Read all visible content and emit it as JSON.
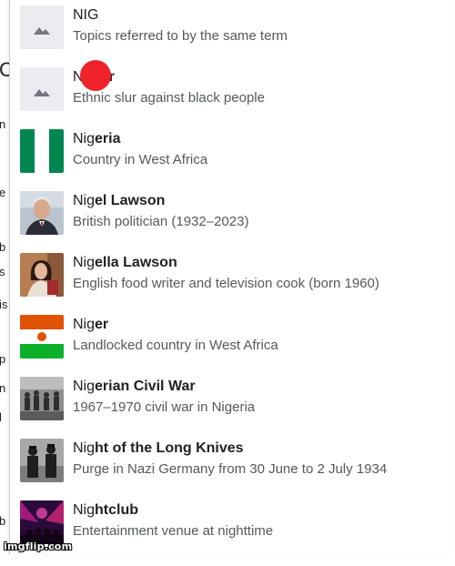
{
  "background_fragments": [
    "C",
    "n",
    "e",
    "b",
    "s",
    "is",
    "p",
    "n",
    "l",
    "b"
  ],
  "suggestions": [
    {
      "title_prefix": "NIG",
      "title_rest": "",
      "description": "Topics referred to by the same term",
      "thumb": "placeholder-image-icon"
    },
    {
      "title_prefix": "N",
      "title_rest": "r",
      "description": "Ethnic slur against black people",
      "thumb": "placeholder-image-icon"
    },
    {
      "title_prefix": "Nig",
      "title_rest": "eria",
      "description": "Country in West Africa",
      "thumb": "nigeria-flag"
    },
    {
      "title_prefix": "Nig",
      "title_rest": "el Lawson",
      "description": "British politician (1932–2023)",
      "thumb": "portrait-photo"
    },
    {
      "title_prefix": "Nig",
      "title_rest": "ella Lawson",
      "description": "English food writer and television cook (born 1960)",
      "thumb": "portrait-photo"
    },
    {
      "title_prefix": "Nig",
      "title_rest": "er",
      "description": "Landlocked country in West Africa",
      "thumb": "niger-flag"
    },
    {
      "title_prefix": "Nig",
      "title_rest": "erian Civil War",
      "description": "1967–1970 civil war in Nigeria",
      "thumb": "war-photo"
    },
    {
      "title_prefix": "Nig",
      "title_rest": "ht of the Long Knives",
      "description": "Purge in Nazi Germany from 30 June to 2 July 1934",
      "thumb": "historical-photo"
    },
    {
      "title_prefix": "Nig",
      "title_rest": "htclub",
      "description": "Entertainment venue at nighttime",
      "thumb": "nightclub-photo"
    }
  ],
  "redaction_color": "#f0222c",
  "watermark": "imgflip.com"
}
